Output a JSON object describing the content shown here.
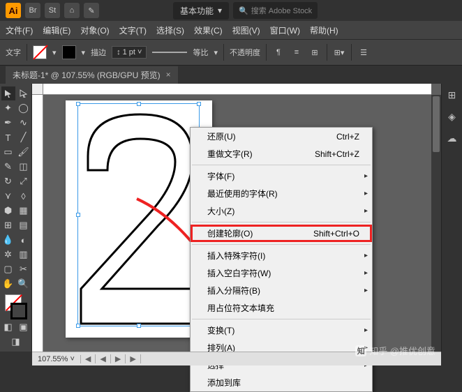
{
  "topbar": {
    "logo": "Ai",
    "icons": [
      "Br",
      "St",
      "⌂",
      "✎"
    ],
    "preset": "基本功能",
    "search_placeholder": "搜索 Adobe Stock"
  },
  "menubar": [
    "文件(F)",
    "编辑(E)",
    "对象(O)",
    "文字(T)",
    "选择(S)",
    "效果(C)",
    "视图(V)",
    "窗口(W)",
    "帮助(H)"
  ],
  "optbar": {
    "label": "文字",
    "stroke_label": "描边",
    "stroke_val": "1 pt",
    "ratio_label": "等比",
    "opacity_label": "不透明度"
  },
  "tab": {
    "title": "未标题-1* @ 107.55% (RGB/GPU 预览)",
    "close": "×"
  },
  "context": {
    "items": [
      {
        "label": "还原(U)",
        "shortcut": "Ctrl+Z"
      },
      {
        "label": "重做文字(R)",
        "shortcut": "Shift+Ctrl+Z"
      },
      "sep",
      {
        "label": "字体(F)",
        "sub": true
      },
      {
        "label": "最近使用的字体(R)",
        "sub": true
      },
      {
        "label": "大小(Z)",
        "sub": true
      },
      "sep",
      {
        "label": "创建轮廓(O)",
        "shortcut": "Shift+Ctrl+O",
        "highlight": true
      },
      "sep",
      {
        "label": "插入特殊字符(I)",
        "sub": true
      },
      {
        "label": "插入空白字符(W)",
        "sub": true
      },
      {
        "label": "插入分隔符(B)",
        "sub": true
      },
      {
        "label": "用占位符文本填充"
      },
      "sep",
      {
        "label": "变换(T)",
        "sub": true
      },
      {
        "label": "排列(A)",
        "sub": true
      },
      {
        "label": "选择",
        "sub": true
      },
      {
        "label": "添加到库"
      }
    ]
  },
  "status": {
    "zoom": "107.55%",
    "nav": [
      "◀",
      "◀",
      "▶",
      "▶"
    ]
  },
  "watermark": "知乎 @推优创意"
}
